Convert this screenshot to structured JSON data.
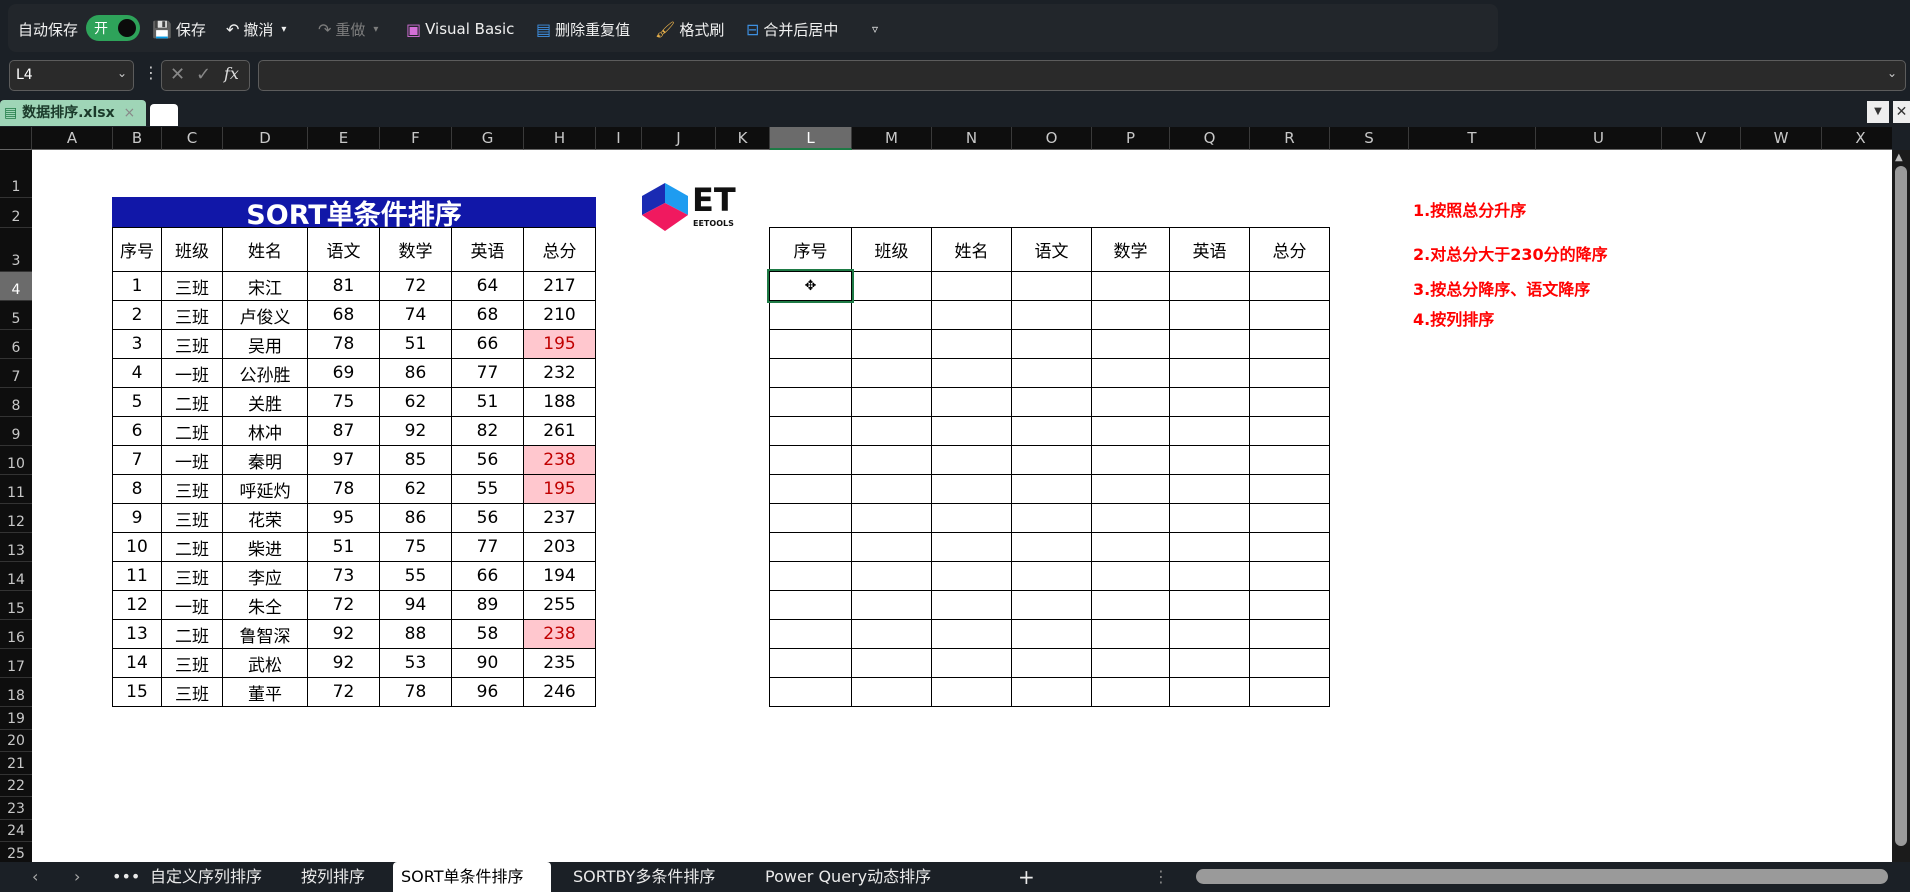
{
  "toolbar": {
    "autosave_label": "自动保存",
    "autosave_state": "开",
    "save": "保存",
    "undo": "撤消",
    "redo": "重做",
    "visual_basic": "Visual Basic",
    "remove_duplicates": "删除重复值",
    "format_painter": "格式刷",
    "merge_center": "合并后居中"
  },
  "formula_bar": {
    "name_box": "L4",
    "formula": "",
    "fx": "fx"
  },
  "file_tab": {
    "name": "数据排序.xlsx"
  },
  "columns": [
    "A",
    "B",
    "C",
    "D",
    "E",
    "F",
    "G",
    "H",
    "I",
    "J",
    "K",
    "L",
    "M",
    "N",
    "O",
    "P",
    "Q",
    "R",
    "S",
    "T",
    "U",
    "V",
    "W",
    "X"
  ],
  "rows": [
    "1",
    "2",
    "3",
    "4",
    "5",
    "6",
    "7",
    "8",
    "9",
    "10",
    "11",
    "12",
    "13",
    "14",
    "15",
    "16",
    "17",
    "18",
    "19",
    "20",
    "21",
    "22",
    "23",
    "24",
    "25"
  ],
  "selected_cell": "L4",
  "source_table": {
    "title": "SORT单条件排序",
    "headers": [
      "序号",
      "班级",
      "姓名",
      "语文",
      "数学",
      "英语",
      "总分"
    ],
    "rows": [
      [
        "1",
        "三班",
        "宋江",
        "81",
        "72",
        "64",
        "217"
      ],
      [
        "2",
        "三班",
        "卢俊义",
        "68",
        "74",
        "68",
        "210"
      ],
      [
        "3",
        "三班",
        "吴用",
        "78",
        "51",
        "66",
        "195"
      ],
      [
        "4",
        "一班",
        "公孙胜",
        "69",
        "86",
        "77",
        "232"
      ],
      [
        "5",
        "二班",
        "关胜",
        "75",
        "62",
        "51",
        "188"
      ],
      [
        "6",
        "二班",
        "林冲",
        "87",
        "92",
        "82",
        "261"
      ],
      [
        "7",
        "一班",
        "秦明",
        "97",
        "85",
        "56",
        "238"
      ],
      [
        "8",
        "三班",
        "呼延灼",
        "78",
        "62",
        "55",
        "195"
      ],
      [
        "9",
        "三班",
        "花荣",
        "95",
        "86",
        "56",
        "237"
      ],
      [
        "10",
        "二班",
        "柴进",
        "51",
        "75",
        "77",
        "203"
      ],
      [
        "11",
        "三班",
        "李应",
        "73",
        "55",
        "66",
        "194"
      ],
      [
        "12",
        "一班",
        "朱仝",
        "72",
        "94",
        "89",
        "255"
      ],
      [
        "13",
        "二班",
        "鲁智深",
        "92",
        "88",
        "58",
        "238"
      ],
      [
        "14",
        "三班",
        "武松",
        "92",
        "53",
        "90",
        "235"
      ],
      [
        "15",
        "三班",
        "董平",
        "72",
        "78",
        "96",
        "246"
      ]
    ],
    "duplicate_highlight_rows": [
      2,
      6,
      7,
      12
    ],
    "highlight_color": "#ffc7ce"
  },
  "result_table": {
    "headers": [
      "序号",
      "班级",
      "姓名",
      "语文",
      "数学",
      "英语",
      "总分"
    ],
    "empty_rows": 15
  },
  "logo": {
    "text": "ET",
    "subtext": "EETOOLS"
  },
  "notes": [
    "1.按照总分升序",
    "2.对总分大于230分的降序",
    "3.按总分降序、语文降序",
    "4.按列排序"
  ],
  "sheet_tabs": [
    {
      "label": "自定义序列排序",
      "active": false
    },
    {
      "label": "按列排序",
      "active": false
    },
    {
      "label": "SORT单条件排序",
      "active": true
    },
    {
      "label": "SORTBY多条件排序",
      "active": false
    },
    {
      "label": "Power Query动态排序",
      "active": false
    }
  ],
  "colors": {
    "title_bg": "#1117a8",
    "note": "#ff0000",
    "toggle": "#2ea35a"
  }
}
